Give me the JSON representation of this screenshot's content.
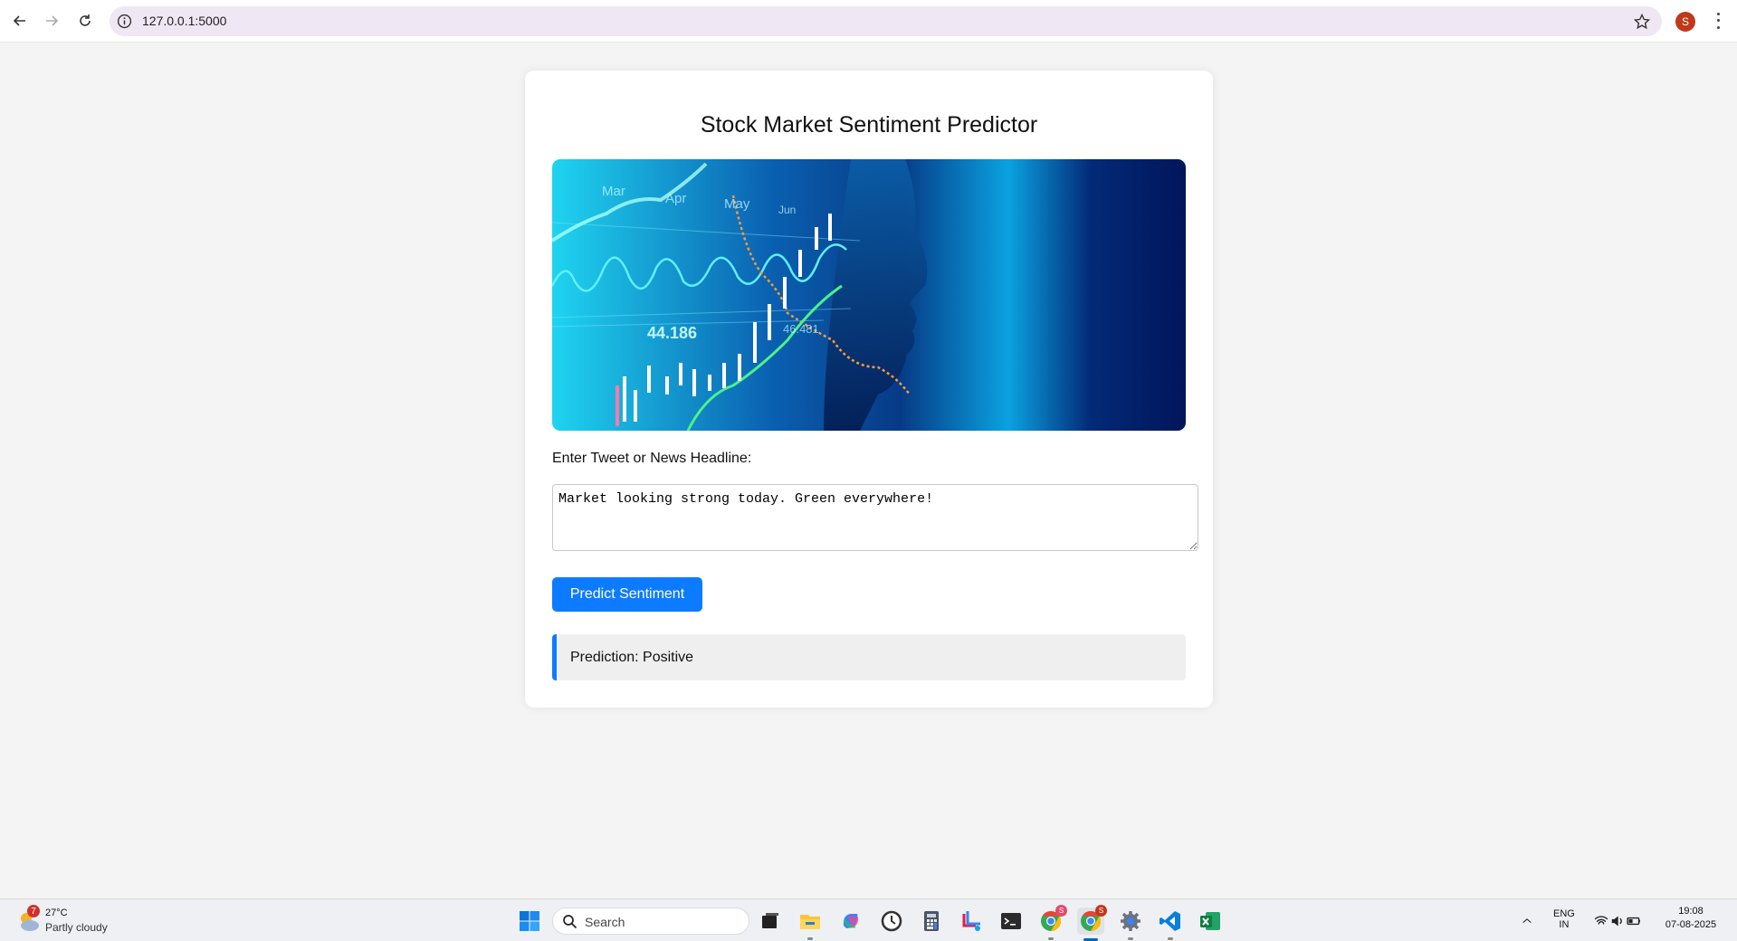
{
  "browser": {
    "url": "127.0.0.1:5000",
    "profile_initial": "S"
  },
  "page": {
    "title": "Stock Market Sentiment Predictor",
    "hero_image_icon": "stock-chart-ai-face-image",
    "hero_labels": {
      "months": [
        "Mar",
        "Apr",
        "May",
        "Jun"
      ],
      "value_main": "44.186",
      "value_secondary": "46.481"
    },
    "input_label": "Enter Tweet or News Headline:",
    "input_value": "Market looking strong today. Green everywhere!",
    "button_label": "Predict Sentiment",
    "prediction_text": "Prediction: Positive",
    "colors": {
      "accent": "#0d7bff",
      "result_bg": "#efefef",
      "page_bg": "#f4f4f4"
    }
  },
  "taskbar": {
    "weather_badge": "7",
    "temperature": "27°C",
    "weather_desc": "Partly cloudy",
    "search_placeholder": "Search",
    "chrome_badge_1": "S",
    "chrome_badge_2": "S",
    "language_line1": "ENG",
    "language_line2": "IN",
    "time": "19:08",
    "date": "07-08-2025"
  }
}
